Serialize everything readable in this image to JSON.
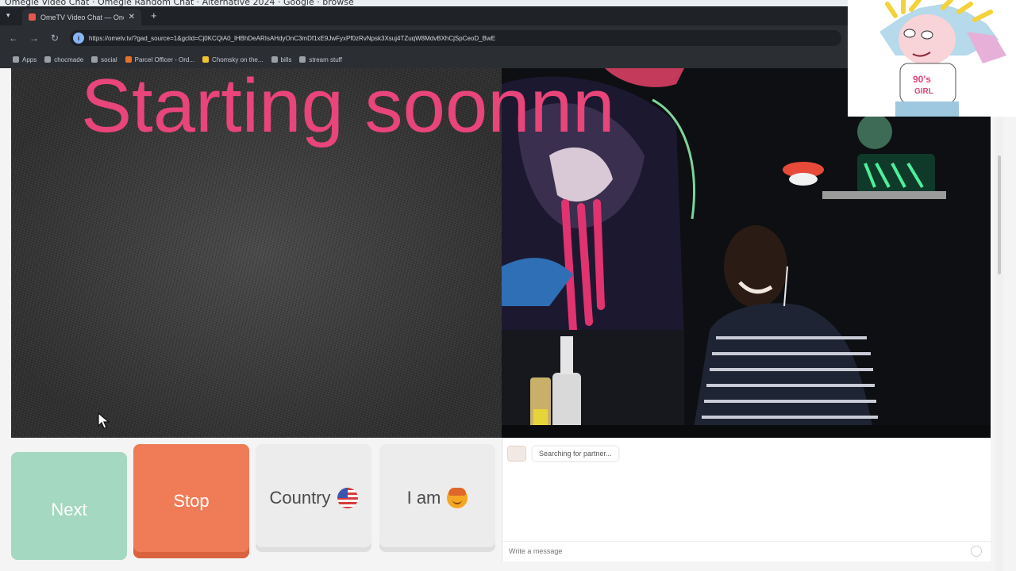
{
  "os_strip": {
    "text": "Omegle Video Chat · Omegle Random Chat · Alternative 2024 · Google · browse"
  },
  "browser": {
    "tab": {
      "title": "OmeTV Video Chat — One"
    },
    "url": "https://ometv.tv/?gad_source=1&gclid=Cj0KCQiA0_lHBhDeARIsAHdyOnC3mDf1xE9JwFyxPf0zRvNpsk3Xsuj4TZuqW8MdvBXhCjSpCeoD_BwE",
    "bookmarks": [
      {
        "label": "Apps",
        "icon": "grid-icon"
      },
      {
        "label": "chocmade",
        "icon": "folder-icon"
      },
      {
        "label": "social",
        "icon": "folder-icon"
      },
      {
        "label": "Parcel Officer - Ord...",
        "icon": "parcel-icon",
        "color": "#e8712b"
      },
      {
        "label": "Chomsky on the...",
        "icon": "bookmark-icon",
        "color": "#f2c230"
      },
      {
        "label": "bills",
        "icon": "folder-icon"
      },
      {
        "label": "stream stuff",
        "icon": "folder-icon"
      }
    ]
  },
  "overlay": {
    "text": "Starting soonnn",
    "color": "#e8457a"
  },
  "controls": {
    "next": "Next",
    "stop": "Stop",
    "country": "Country",
    "iam": "I am"
  },
  "chat": {
    "status_message": "Searching for partner...",
    "input_placeholder": "Write a message"
  },
  "colors": {
    "next_bg": "#a5d8c0",
    "stop_bg": "#ef7b57",
    "neutral_bg": "#ececec"
  }
}
